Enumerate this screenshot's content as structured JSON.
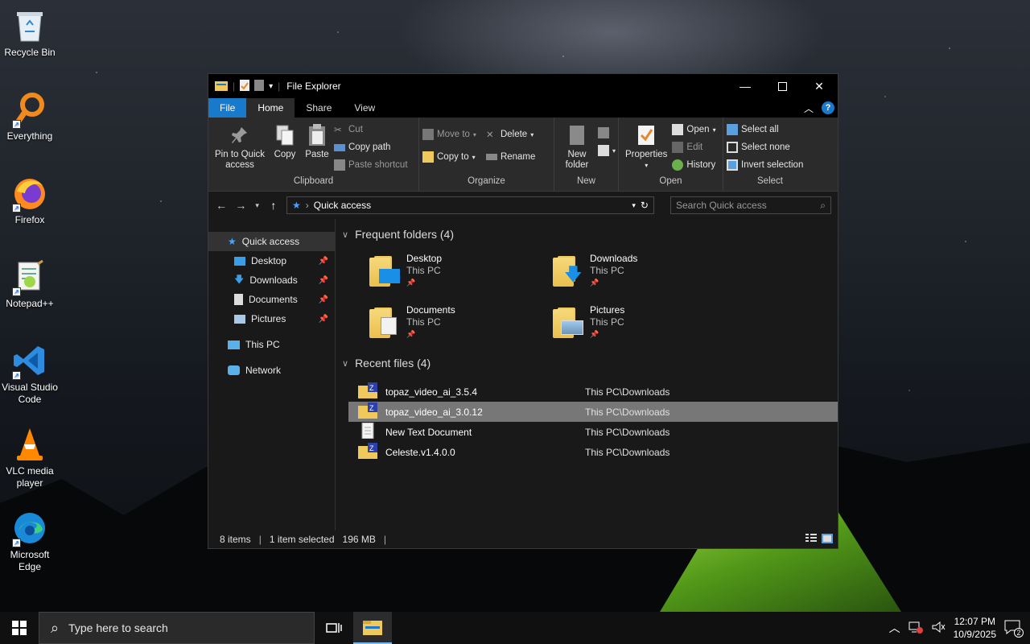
{
  "desktop": {
    "icons": [
      {
        "label": "Recycle Bin",
        "icon": "recycle-bin-icon"
      },
      {
        "label": "Everything",
        "icon": "everything-icon"
      },
      {
        "label": "Firefox",
        "icon": "firefox-icon"
      },
      {
        "label": "Notepad++",
        "icon": "notepadpp-icon"
      },
      {
        "label": "Visual Studio Code",
        "icon": "vscode-icon"
      },
      {
        "label": "VLC media player",
        "icon": "vlc-icon"
      },
      {
        "label": "Microsoft Edge",
        "icon": "edge-icon"
      }
    ]
  },
  "window": {
    "title": "File Explorer"
  },
  "tabs": {
    "file": "File",
    "home": "Home",
    "share": "Share",
    "view": "View"
  },
  "ribbon": {
    "clipboard": {
      "name": "Clipboard",
      "pin": "Pin to Quick access",
      "copy": "Copy",
      "paste": "Paste",
      "cut": "Cut",
      "copy_path": "Copy path",
      "paste_shortcut": "Paste shortcut"
    },
    "organize": {
      "name": "Organize",
      "move_to": "Move to",
      "copy_to": "Copy to",
      "delete": "Delete",
      "rename": "Rename"
    },
    "new": {
      "name": "New",
      "new_folder": "New folder"
    },
    "open": {
      "name": "Open",
      "properties": "Properties",
      "open": "Open",
      "edit": "Edit",
      "history": "History"
    },
    "select": {
      "name": "Select",
      "select_all": "Select all",
      "select_none": "Select none",
      "invert": "Invert selection"
    }
  },
  "address": {
    "path": "Quick access",
    "search_placeholder": "Search Quick access"
  },
  "nav": {
    "quick_access": "Quick access",
    "desktop": "Desktop",
    "downloads": "Downloads",
    "documents": "Documents",
    "pictures": "Pictures",
    "this_pc": "This PC",
    "network": "Network"
  },
  "frequent": {
    "header": "Frequent folders (4)",
    "folders": [
      {
        "name": "Desktop",
        "location": "This PC"
      },
      {
        "name": "Downloads",
        "location": "This PC"
      },
      {
        "name": "Documents",
        "location": "This PC"
      },
      {
        "name": "Pictures",
        "location": "This PC"
      }
    ]
  },
  "recent": {
    "header": "Recent files (4)",
    "files": [
      {
        "name": "topaz_video_ai_3.5.4",
        "location": "This PC\\Downloads",
        "icon": "zip-folder-icon"
      },
      {
        "name": "topaz_video_ai_3.0.12",
        "location": "This PC\\Downloads",
        "icon": "zip-folder-icon"
      },
      {
        "name": "New Text Document",
        "location": "This PC\\Downloads",
        "icon": "text-file-icon"
      },
      {
        "name": "Celeste.v1.4.0.0",
        "location": "This PC\\Downloads",
        "icon": "zip-folder-icon"
      }
    ]
  },
  "status": {
    "count": "8 items",
    "selected": "1 item selected",
    "size": "196 MB"
  },
  "taskbar": {
    "search_placeholder": "Type here to search",
    "time": "12:07 PM",
    "date": "10/9/2025",
    "notifications": "2"
  },
  "colors": {
    "accent": "#1979ca",
    "selection": "#777777",
    "folder": "#f0c95c"
  }
}
